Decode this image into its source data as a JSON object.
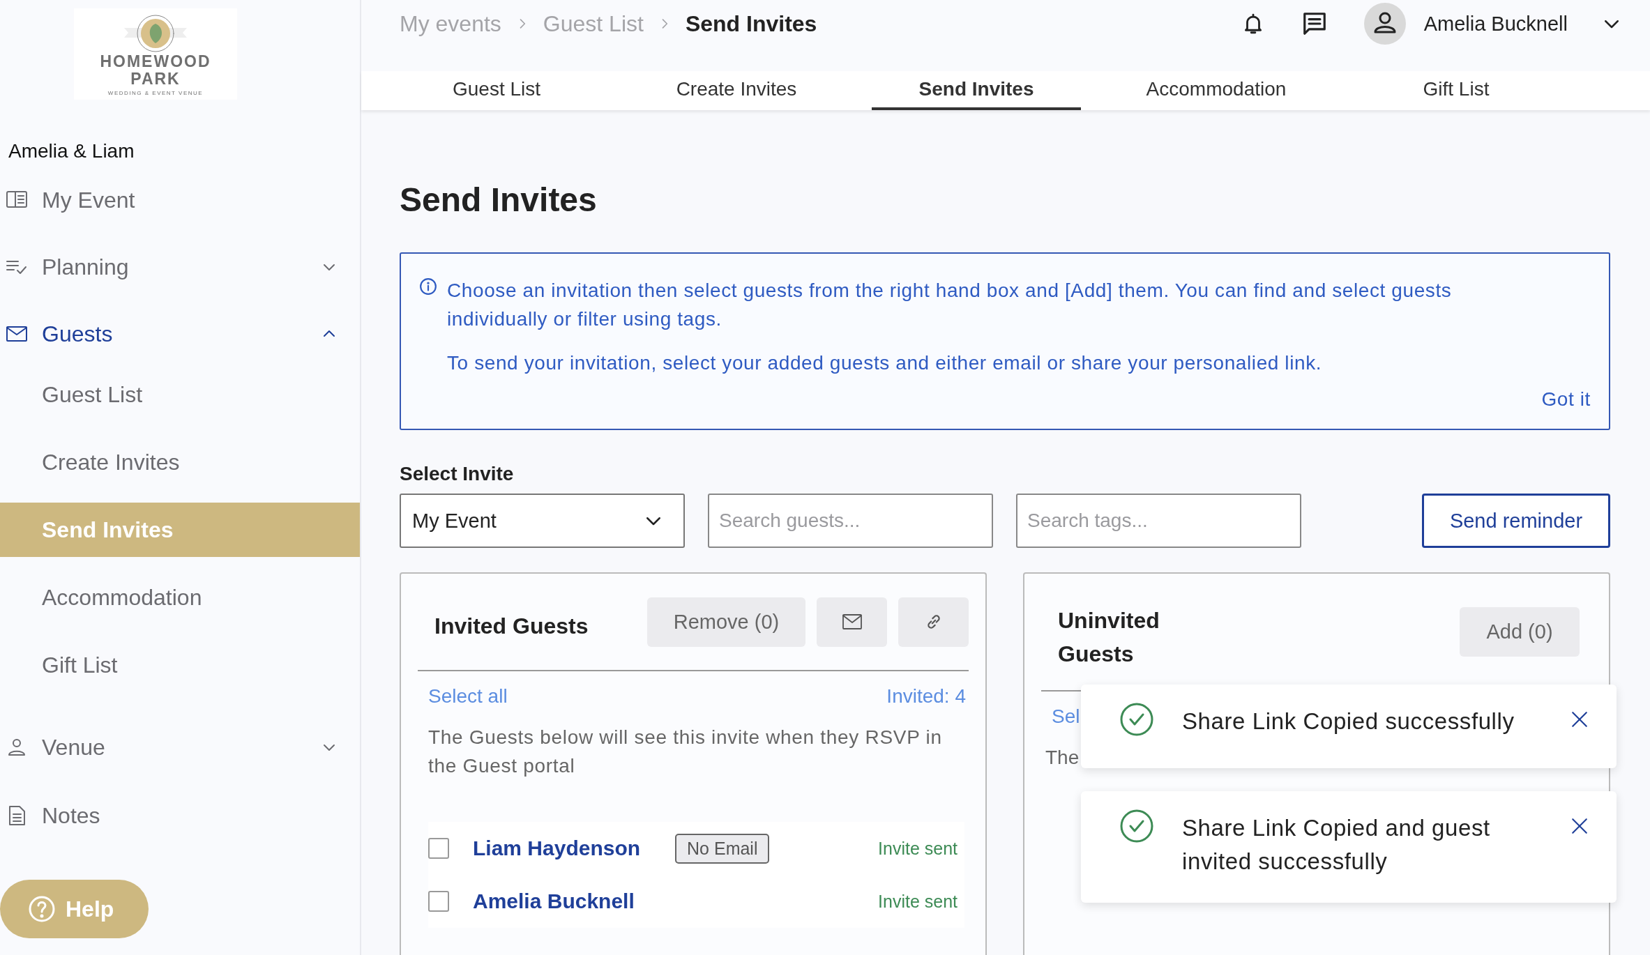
{
  "logo": {
    "name": "HOMEWOOD PARK",
    "tagline": "WEDDING & EVENT VENUE"
  },
  "event_name": "Amelia & Liam",
  "sidebar": {
    "items": [
      {
        "label": "My Event",
        "kind": "book",
        "selected": false
      },
      {
        "label": "Planning",
        "kind": "checklist",
        "selected": false,
        "expanded": false
      },
      {
        "label": "Guests",
        "kind": "mail",
        "selected": true,
        "expanded": true,
        "children": [
          {
            "label": "Guest List",
            "selected": false
          },
          {
            "label": "Create Invites",
            "selected": false
          },
          {
            "label": "Send Invites",
            "selected": true
          },
          {
            "label": "Accommodation",
            "selected": false
          },
          {
            "label": "Gift List",
            "selected": false
          }
        ]
      },
      {
        "label": "Venue",
        "kind": "person",
        "selected": false,
        "expanded": false
      },
      {
        "label": "Notes",
        "kind": "document",
        "selected": false
      }
    ]
  },
  "help_button": {
    "label": "Help"
  },
  "breadcrumb": [
    {
      "label": "My events",
      "selected": false
    },
    {
      "label": "Guest List",
      "selected": false
    },
    {
      "label": "Send Invites",
      "selected": true
    }
  ],
  "user": {
    "name": "Amelia Bucknell"
  },
  "tabs": [
    {
      "label": "Guest List",
      "selected": false
    },
    {
      "label": "Create Invites",
      "selected": false
    },
    {
      "label": "Send Invites",
      "selected": true
    },
    {
      "label": "Accommodation",
      "selected": false
    },
    {
      "label": "Gift List",
      "selected": false
    }
  ],
  "page_title": "Send Invites",
  "info": {
    "paragraphs": [
      "Choose an invitation then select guests from the right hand box and [Add] them. You can find and select guests individually or filter using tags.",
      "To send your invitation, select your added guests and either email or share your personalied link."
    ],
    "action": "Got it"
  },
  "select_invite": {
    "label": "Select Invite",
    "value": "My Event"
  },
  "search_guests": {
    "placeholder": "Search guests..."
  },
  "search_tags": {
    "placeholder": "Search tags..."
  },
  "send_reminder": "Send reminder",
  "invited_panel": {
    "title": "Invited Guests",
    "remove_button": "Remove (0)",
    "select_all": "Select all",
    "count": "Invited: 4",
    "description": "The Guests below will see this invite when they RSVP in the Guest portal",
    "guests": [
      {
        "name": "Liam Haydenson",
        "tag": "No Email",
        "status": "Invite sent",
        "checked": false
      },
      {
        "name": "Amelia Bucknell",
        "status": "Invite sent",
        "checked": false
      }
    ]
  },
  "uninvited_panel": {
    "title": "Uninvited Guests",
    "add_button": "Add (0)",
    "select_all": "Sel",
    "description": "The"
  },
  "toasts": [
    {
      "message": "Share Link Copied successfully"
    },
    {
      "message": "Share Link Copied and guest invited successfully"
    }
  ]
}
